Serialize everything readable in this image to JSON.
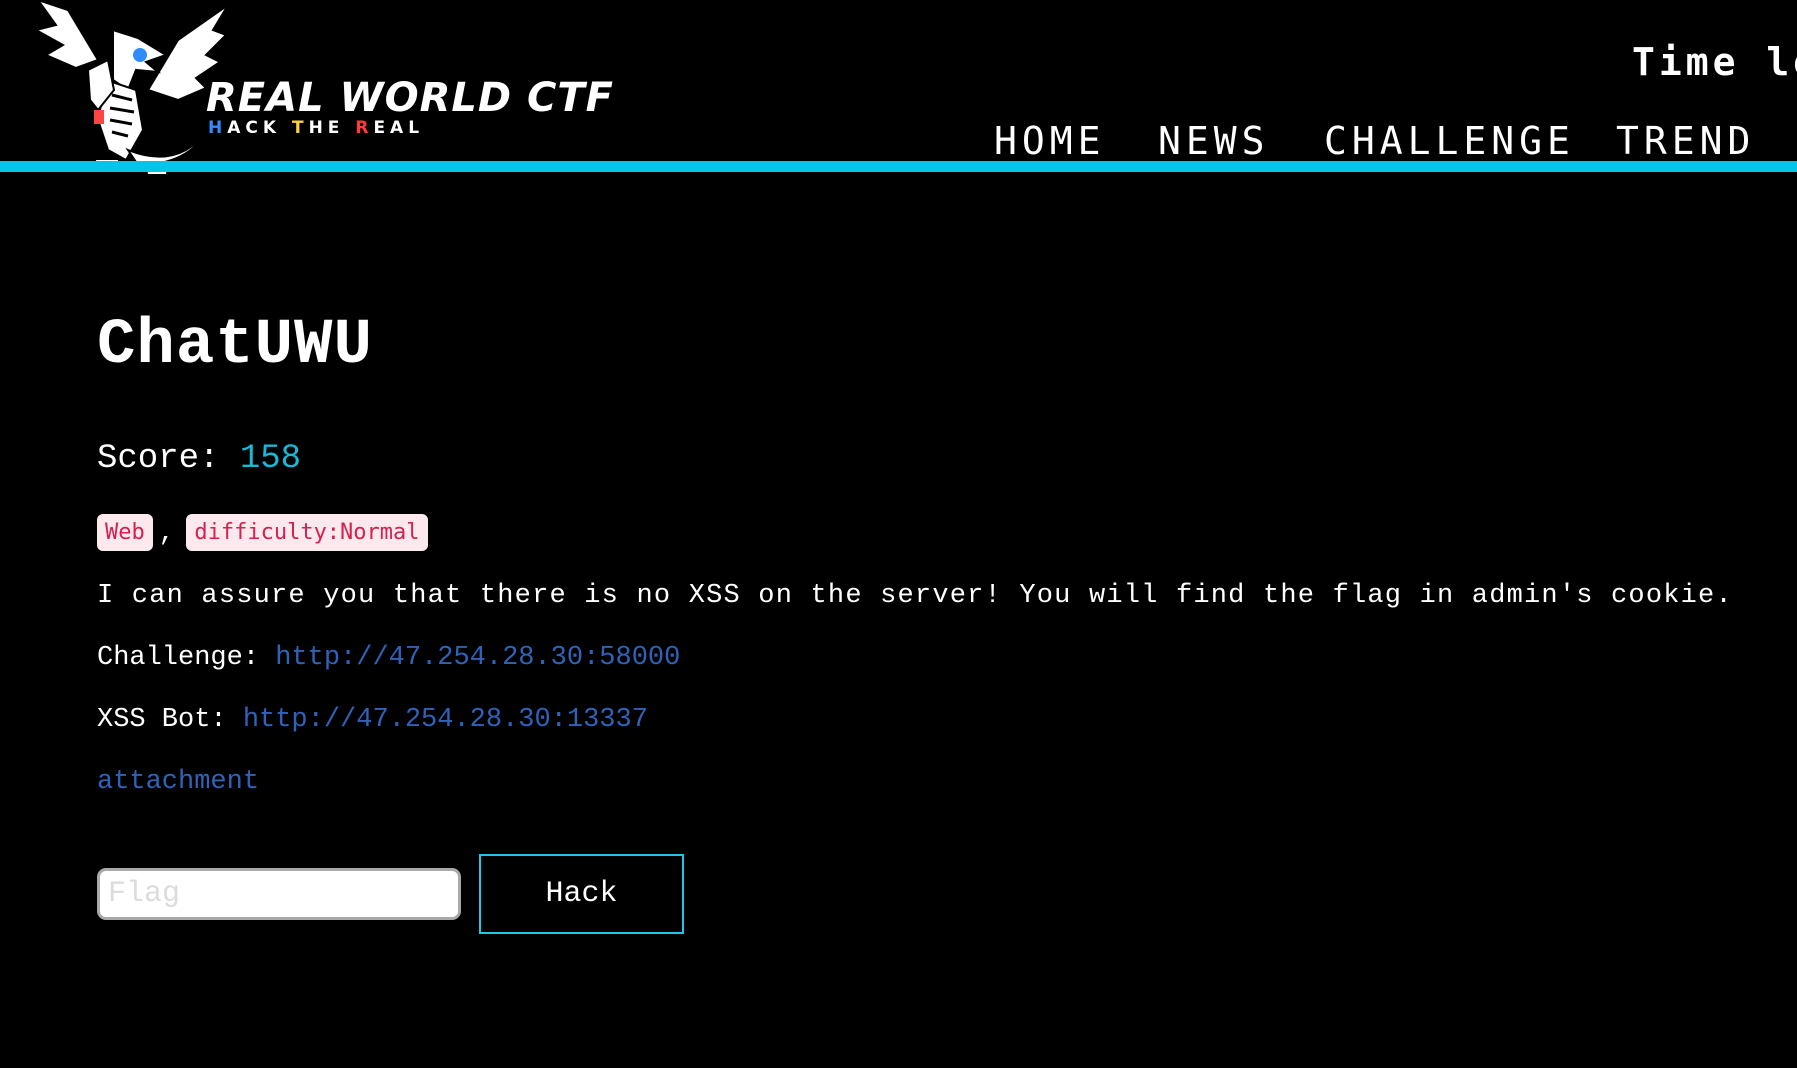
{
  "header": {
    "logo": {
      "title": "REAL WORLD CTF",
      "slogan": [
        "H",
        "ACK ",
        "T",
        "HE ",
        "R",
        "EAL"
      ]
    },
    "timer_text": "Time le",
    "nav": {
      "home": "HOME",
      "news": "NEWS",
      "challenge": "CHALLENGE",
      "trend": "TREND"
    },
    "accent_color": "#00c7e6"
  },
  "challenge": {
    "title": "ChatUWU",
    "score_label": "Score: ",
    "score_value": "158",
    "tags": [
      "Web",
      "difficulty:Normal"
    ],
    "tag_separator": ",",
    "description": "I can assure you that there is no XSS on the server! You will find the flag in admin's cookie.",
    "challenge_label": "Challenge: ",
    "challenge_url": "http://47.254.28.30:58000",
    "bot_label": "XSS Bot: ",
    "bot_url": "http://47.254.28.30:13337",
    "attachment_label": "attachment"
  },
  "form": {
    "flag_placeholder": "Flag",
    "flag_value": "",
    "hack_label": "Hack"
  },
  "colors": {
    "score": "#17b8d8",
    "link": "#2f62b8",
    "tag_bg": "#fbe9ee",
    "tag_text": "#d6204e",
    "button_border": "#1fc7e6"
  }
}
